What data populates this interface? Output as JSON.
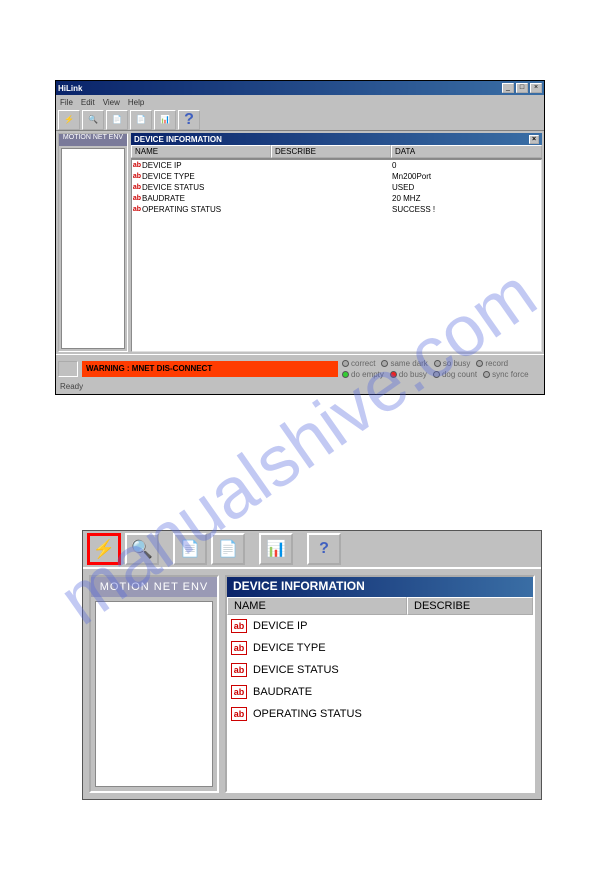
{
  "watermark": "manualshive.com",
  "top_window": {
    "title": "HiLink",
    "menu": [
      "File",
      "Edit",
      "View",
      "Help"
    ],
    "sidebar_header": "MOTION NET ENV",
    "info_panel": {
      "title": "DEVICE INFORMATION",
      "columns": {
        "name": "NAME",
        "describe": "DESCRIBE",
        "data": "DATA"
      },
      "rows": [
        {
          "name": "DEVICE IP",
          "data": "0"
        },
        {
          "name": "DEVICE TYPE",
          "data": "Mn200Port"
        },
        {
          "name": "DEVICE STATUS",
          "data": "USED"
        },
        {
          "name": "BAUDRATE",
          "data": "20 MHZ"
        },
        {
          "name": "OPERATING STATUS",
          "data": "SUCCESS !"
        }
      ]
    },
    "status": {
      "msg": "WARNING : MNET DIS-CONNECT",
      "leds": [
        {
          "name": "correct",
          "cls": "led-gray"
        },
        {
          "name": "same dark",
          "cls": "led-gray"
        },
        {
          "name": "so busy",
          "cls": "led-gray"
        },
        {
          "name": "record",
          "cls": "led-gray"
        },
        {
          "name": "do empty",
          "cls": "led-green"
        },
        {
          "name": "do busy",
          "cls": "led-red"
        },
        {
          "name": "dog count",
          "cls": "led-gray"
        },
        {
          "name": "sync force",
          "cls": "led-gray"
        }
      ],
      "ready": "Ready"
    }
  },
  "bottom_window": {
    "sidebar_header": "MOTION NET ENV",
    "info_panel": {
      "title": "DEVICE INFORMATION",
      "columns": {
        "name": "NAME",
        "describe": "DESCRIBE"
      },
      "rows": [
        {
          "name": "DEVICE IP"
        },
        {
          "name": "DEVICE TYPE"
        },
        {
          "name": "DEVICE STATUS"
        },
        {
          "name": "BAUDRATE"
        },
        {
          "name": "OPERATING STATUS"
        }
      ]
    }
  }
}
